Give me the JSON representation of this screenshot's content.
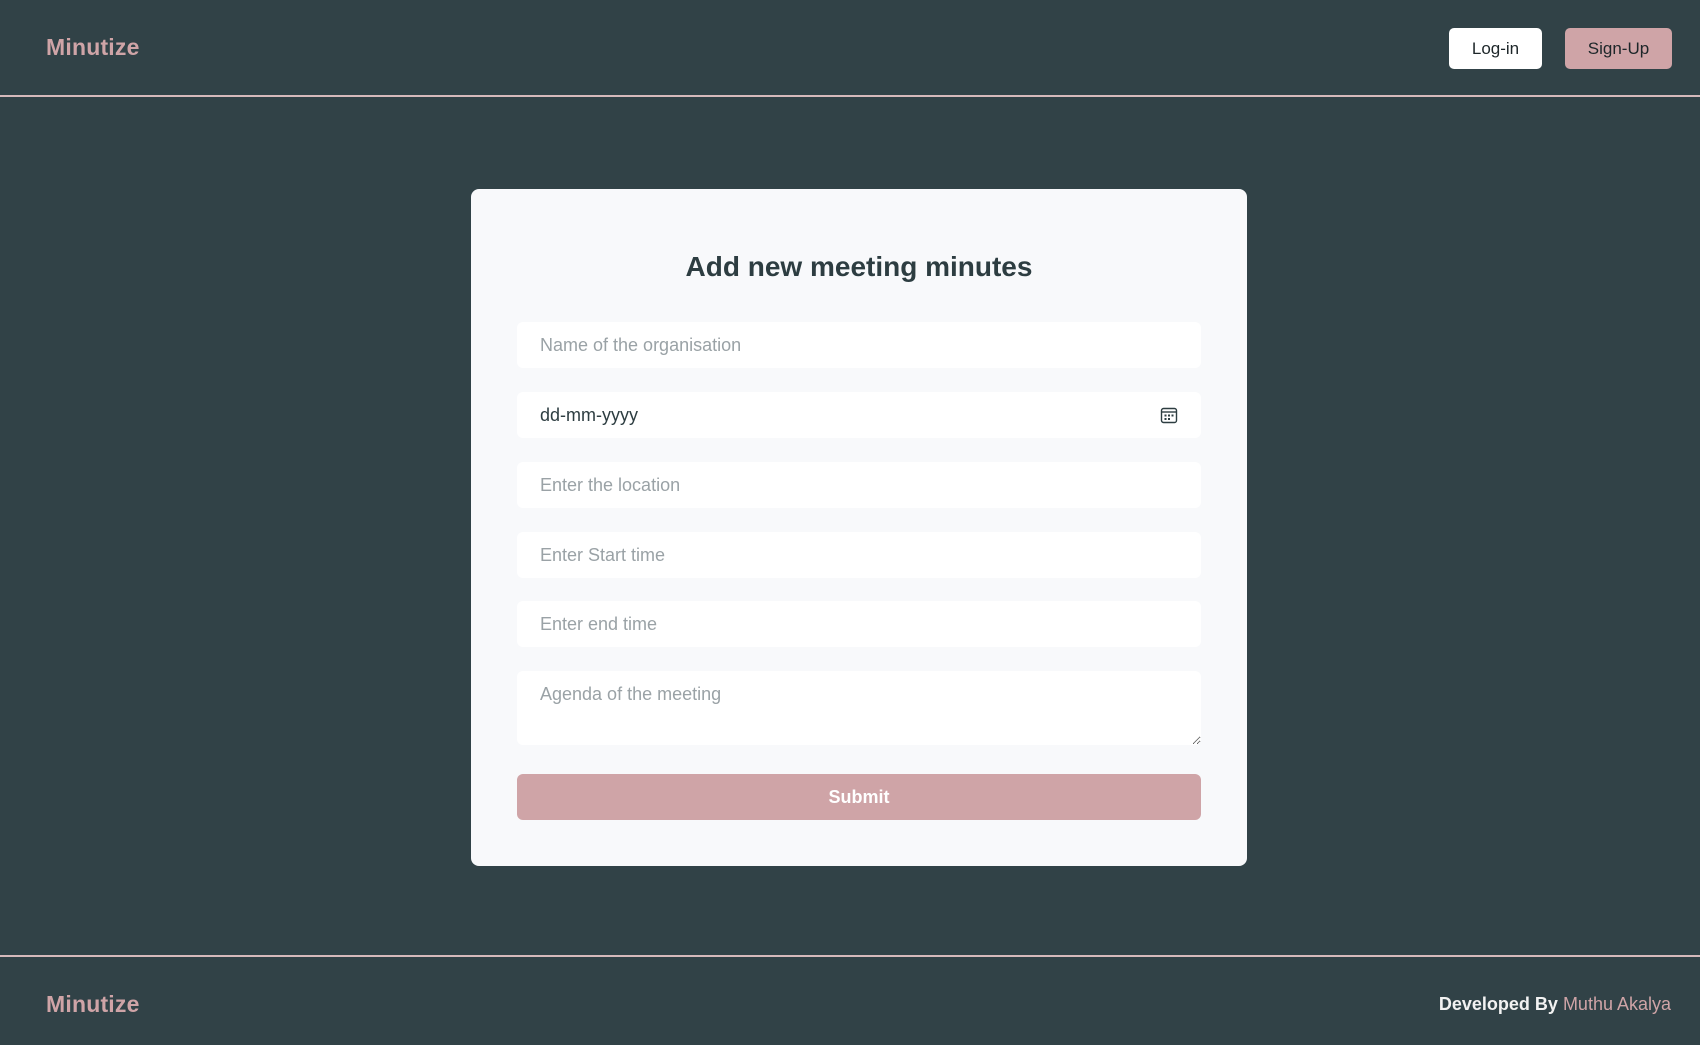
{
  "header": {
    "brand": "Minutize",
    "login_label": "Log-in",
    "signup_label": "Sign-Up"
  },
  "form": {
    "title": "Add new meeting minutes",
    "organisation_placeholder": "Name of the organisation",
    "date_placeholder": "dd-mm-yyyy",
    "location_placeholder": "Enter the location",
    "start_time_placeholder": "Enter Start time",
    "end_time_placeholder": "Enter end time",
    "agenda_placeholder": "Agenda of the meeting",
    "submit_label": "Submit",
    "calendar_icon": "calendar-icon"
  },
  "footer": {
    "brand": "Minutize",
    "credit_prefix": "Developed By",
    "author": "Muthu Akalya"
  },
  "colors": {
    "background": "#314247",
    "accent": "#cfa4a7",
    "card": "#f8f9fb",
    "title": "#2d3d41"
  }
}
